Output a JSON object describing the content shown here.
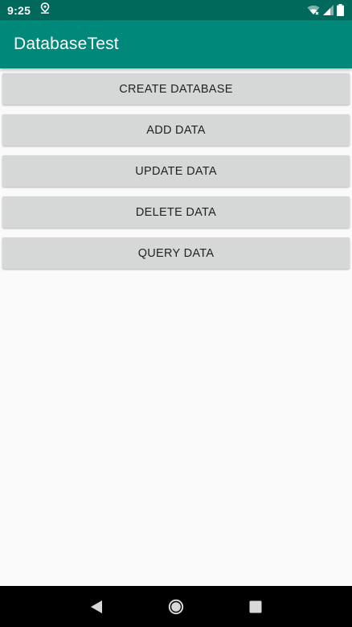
{
  "status_bar": {
    "time": "9:25",
    "icons": [
      "location-icon",
      "wifi-icon",
      "signal-icon",
      "battery-icon"
    ]
  },
  "app_bar": {
    "title": "DatabaseTest",
    "color": "#00897b"
  },
  "buttons": [
    {
      "label": "CREATE DATABASE"
    },
    {
      "label": "ADD DATA"
    },
    {
      "label": "UPDATE DATA"
    },
    {
      "label": "DELETE DATA"
    },
    {
      "label": "QUERY DATA"
    }
  ],
  "nav_bar": {
    "icons": [
      "back-icon",
      "home-icon",
      "recents-icon"
    ]
  }
}
